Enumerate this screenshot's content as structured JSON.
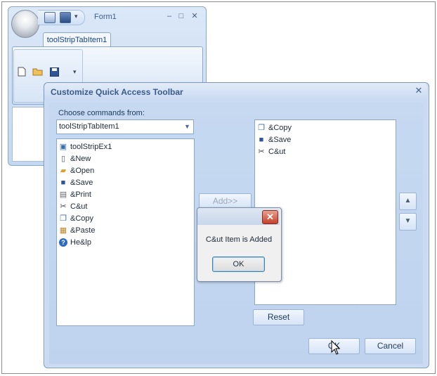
{
  "form1": {
    "title": "Form1",
    "tab_label": "toolStripTabItem1",
    "window_buttons": {
      "minimize": "–",
      "maximize": "□",
      "close": "✕"
    }
  },
  "dialog": {
    "title": "Customize Quick Access Toolbar",
    "close_glyph": "✕",
    "choose_label": "Choose commands from:",
    "combo_value": "toolStripTabItem1",
    "left_items": [
      {
        "label": "toolStripEx1",
        "icon": "image-icon"
      },
      {
        "label": "&New",
        "icon": "new-document-icon"
      },
      {
        "label": "&Open",
        "icon": "open-folder-icon"
      },
      {
        "label": "&Save",
        "icon": "save-disk-icon"
      },
      {
        "label": "&Print",
        "icon": "printer-icon"
      },
      {
        "label": "C&ut",
        "icon": "scissors-icon"
      },
      {
        "label": "&Copy",
        "icon": "copy-icon"
      },
      {
        "label": "&Paste",
        "icon": "paste-icon"
      },
      {
        "label": "He&lp",
        "icon": "help-icon"
      }
    ],
    "right_items": [
      {
        "label": "&Copy",
        "icon": "copy-icon"
      },
      {
        "label": "&Save",
        "icon": "save-disk-icon"
      },
      {
        "label": "C&ut",
        "icon": "scissors-icon"
      }
    ],
    "add_label": "Add>>",
    "reset_label": "Reset",
    "ok_label": "OK",
    "cancel_label": "Cancel"
  },
  "message_box": {
    "text": "C&ut Item is Added",
    "ok_label": "OK"
  },
  "colors": {
    "accent": "#15428b",
    "dialog_bg": "#c9daf2",
    "close_red": "#c4412a"
  }
}
